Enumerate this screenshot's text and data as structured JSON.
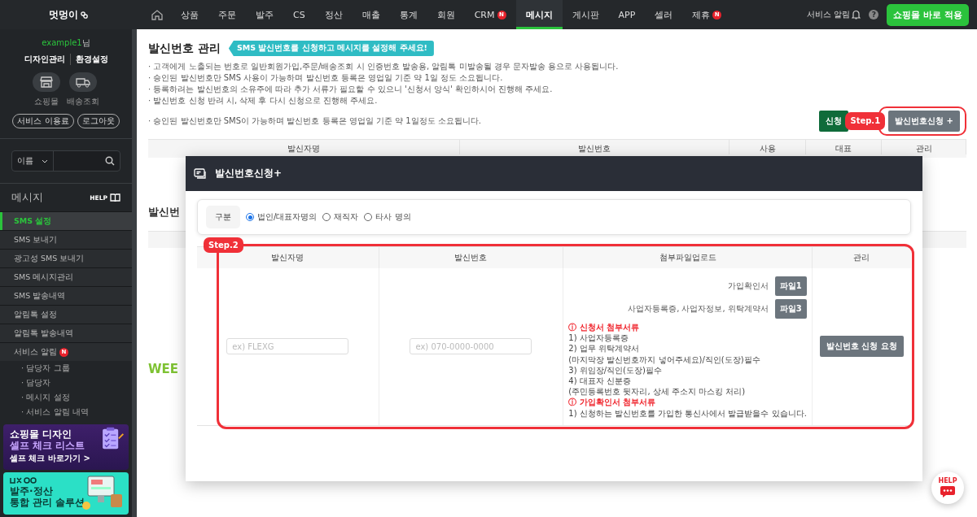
{
  "topbar": {
    "logo": "멋멍이",
    "nav": [
      {
        "label": "상품",
        "selected": false
      },
      {
        "label": "주문",
        "selected": false
      },
      {
        "label": "발주",
        "selected": false
      },
      {
        "label": "CS",
        "selected": false
      },
      {
        "label": "정산",
        "selected": false
      },
      {
        "label": "매출",
        "selected": false
      },
      {
        "label": "통계",
        "selected": false
      },
      {
        "label": "회원",
        "selected": false
      },
      {
        "label": "CRM",
        "selected": false,
        "badge": "N"
      },
      {
        "label": "메시지",
        "selected": true
      },
      {
        "label": "게시판",
        "selected": false
      },
      {
        "label": "APP",
        "selected": false
      },
      {
        "label": "셀러",
        "selected": false
      },
      {
        "label": "제휴",
        "selected": false,
        "badge": "N"
      }
    ],
    "service_alert": "서비스 알림",
    "help": "?",
    "apply_button": "쇼핑몰 바로 적용"
  },
  "sidebar": {
    "user_id": "example1",
    "user_suffix": "님",
    "links": [
      "디자인관리",
      "환경설정"
    ],
    "shortcuts": [
      {
        "kind": "shop",
        "label": "쇼핑몰"
      },
      {
        "kind": "delivery",
        "label": "배송조회"
      }
    ],
    "pills": [
      "서비스 이용료",
      "로그아웃"
    ],
    "search": {
      "select": "이름"
    },
    "section_title": "메시지",
    "help_label": "HELP",
    "menu": [
      {
        "label": "SMS 설정",
        "selected": true
      },
      {
        "label": "SMS 보내기",
        "selected": false
      },
      {
        "label": "광고성 SMS 보내기",
        "selected": false
      },
      {
        "label": "SMS 메시지관리",
        "selected": false
      },
      {
        "label": "SMS 발송내역",
        "selected": false
      },
      {
        "label": "알림톡 설정",
        "selected": false
      },
      {
        "label": "알림톡 발송내역",
        "selected": false
      },
      {
        "label": "서비스 알림",
        "selected": false,
        "badge": "N",
        "children": [
          {
            "label": "· 담당자 그룹"
          },
          {
            "label": "· 담당자"
          },
          {
            "label": "· 메시지 설정"
          },
          {
            "label": "· 서비스 알림 내역"
          }
        ]
      }
    ],
    "banners": [
      {
        "kind": "design",
        "lines": [
          "쇼핑몰 디자인",
          "셀프 체크 리스트"
        ],
        "link": "셀프 체크 바로가기 >"
      },
      {
        "kind": "solution",
        "lines": [
          "발주·정산",
          "통합 관리 솔루션"
        ]
      }
    ]
  },
  "page": {
    "title": "발신번호 관리",
    "callout": "SMS 발신번호를 신청하고 메시지를 설정해 주세요!",
    "notes": [
      "· 고객에게 노출되는 번호로 일반회원가입,주문/배송조회 시 인증번호 발송용, 알림톡 미발송될 경우 문자발송 용으로 사용됩니다.",
      "· 승인된 발신번호만 SMS 사용이 가능하며 발신번호 등록은 영업일 기준 약 1일 정도 소요됩니다.",
      "· 등록하려는 발신번호의 소유주에 따라 추가 서류가 필요할 수 있으니 '신청서 양식' 확인하시어 진행해 주세요.",
      "· 발신번호 신청 반려 시, 삭제 후 다시 신청으로 진행해 주세요.",
      "· 승인된 발신번호만 SMS이 가능하며 발신번호 등록은 영업일 기준 약 1일정도 소요됩니다."
    ],
    "form_button": "신청",
    "step1_badge": "Step.1",
    "apply_button": "발신번호신청 +",
    "table_columns": [
      "발신자명",
      "발신번호",
      "사용",
      "대표",
      "관리"
    ],
    "second_title": "발신번",
    "brand_text": "WEE"
  },
  "modal": {
    "title": "발신번호신청+",
    "category_label": "구분",
    "options": [
      {
        "label": "법인/대표자명의",
        "selected": true
      },
      {
        "label": "재직자",
        "selected": false
      },
      {
        "label": "타사 명의",
        "selected": false
      }
    ],
    "step2_badge": "Step.2",
    "columns": [
      "발신자명",
      "발신번호",
      "첨부파일업로드",
      "관리"
    ],
    "sender_name": {
      "placeholder": "ex) FLEXG"
    },
    "sender_number": {
      "placeholder": "ex) 070-0000-0000"
    },
    "uploads": [
      {
        "label": "가입확인서",
        "button": "파일1"
      },
      {
        "label": "사업자등록증, 사업자정보, 위탁계약서",
        "button": "파일3"
      }
    ],
    "guide": [
      {
        "kind": "heading",
        "text": "ⓘ 신청서 첨부서류"
      },
      {
        "kind": "line",
        "text": "1) 사업자등록증"
      },
      {
        "kind": "line",
        "text": "2) 업무 위탁계약서"
      },
      {
        "kind": "line",
        "text": "(마지막장 발신번호까지 넣어주세요)/직인(도장)필수"
      },
      {
        "kind": "line",
        "text": "3) 위임장/직인(도장)필수"
      },
      {
        "kind": "line",
        "text": "4) 대표자 신분증"
      },
      {
        "kind": "line",
        "text": "(주민등록번호 뒷자리, 상세 주소지 마스킹 처리)"
      },
      {
        "kind": "heading",
        "text": "ⓘ 가입확인서 첨부서류"
      },
      {
        "kind": "line",
        "text": "1) 신청하는 발신번호를 가입한 통신사에서 발급받을수 있습니다."
      }
    ],
    "submit_button": "발신번호 신청 요청"
  },
  "help_widget": {
    "label": "HELP"
  }
}
